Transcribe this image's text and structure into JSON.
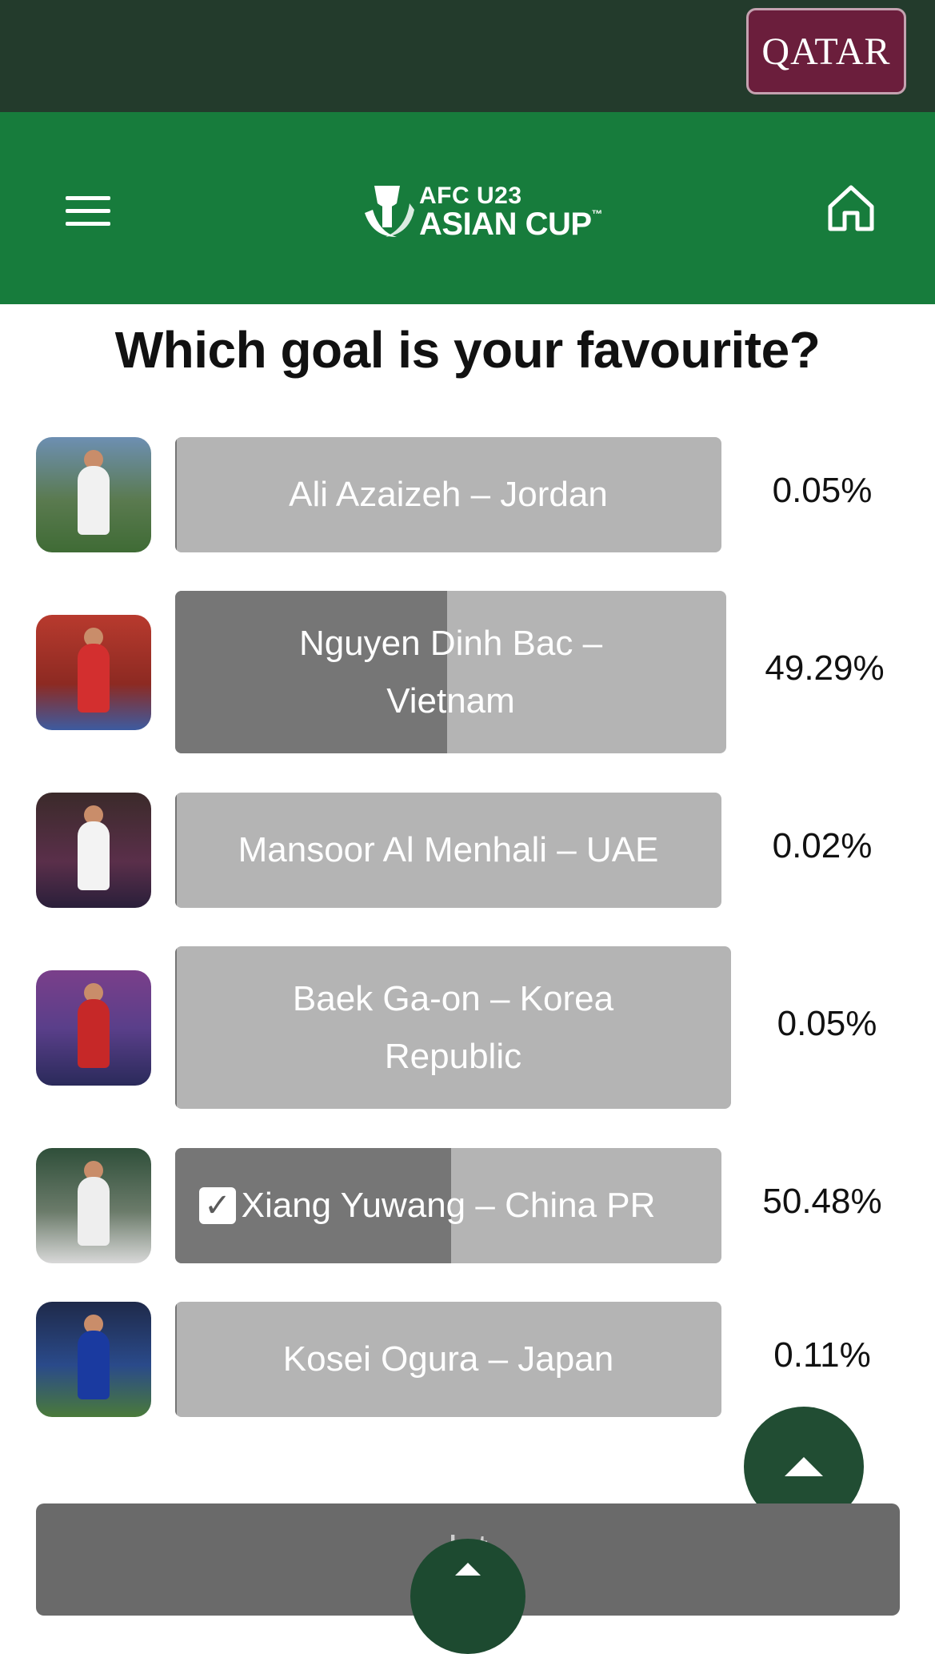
{
  "header": {
    "sponsor_label": "QATAR",
    "logo_line1": "AFC U23",
    "logo_line2": "ASIAN CUP",
    "logo_tm": "™"
  },
  "poll": {
    "title": "Which goal is your favourite?",
    "options": [
      {
        "label": "Ali Azaizeh – Jordan",
        "percent": "0.05%",
        "fill_fraction": 0.0005,
        "selected": false
      },
      {
        "label": "Nguyen Dinh Bac – Vietnam",
        "percent": "49.29%",
        "fill_fraction": 0.4929,
        "selected": false
      },
      {
        "label": "Mansoor Al Menhali – UAE",
        "percent": "0.02%",
        "fill_fraction": 0.0002,
        "selected": false
      },
      {
        "label": "Baek Ga-on – Korea Republic",
        "percent": "0.05%",
        "fill_fraction": 0.0005,
        "selected": false
      },
      {
        "label": "Xiang Yuwang – China PR",
        "percent": "50.48%",
        "fill_fraction": 0.5048,
        "selected": true,
        "check_icon": "check-icon"
      },
      {
        "label": "Kosei Ogura – Japan",
        "percent": "0.11%",
        "fill_fraction": 0.0011,
        "selected": false
      }
    ]
  },
  "footer": {
    "button_label": "L      t",
    "scroll_top_icon": "arrow-up-icon"
  },
  "colors": {
    "topbar": "#233b2c",
    "navbar": "#177c3c",
    "sponsor": "#6b1e3c",
    "bar_bg": "#b4b4b4",
    "bar_fill": "#767676"
  }
}
